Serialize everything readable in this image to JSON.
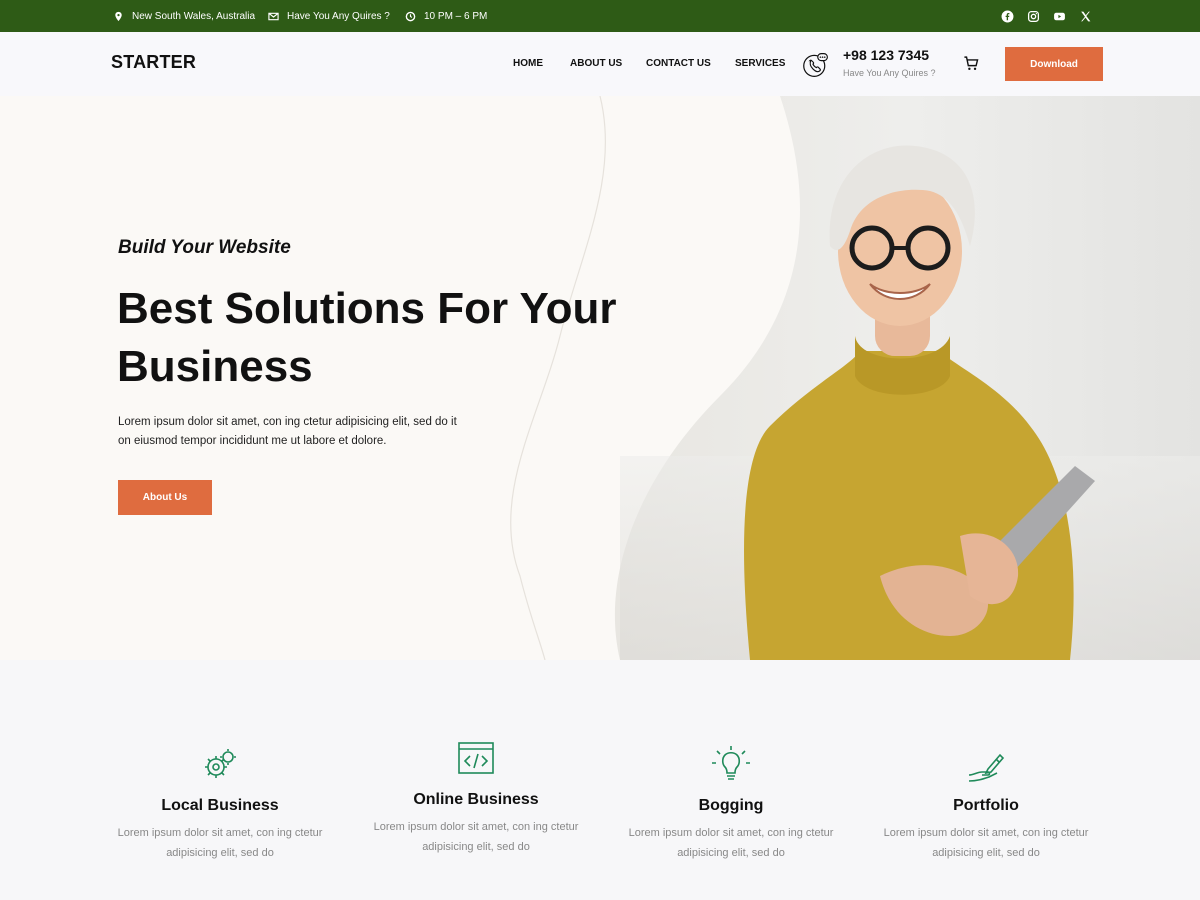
{
  "topbar": {
    "location": "New South Wales, Australia",
    "email": "Have You Any Quires ?",
    "hours": "10 PM – 6 PM",
    "social": [
      "facebook-icon",
      "instagram-icon",
      "youtube-icon",
      "x-icon"
    ]
  },
  "header": {
    "logo": "STARTER",
    "nav": [
      "HOME",
      "ABOUT US",
      "CONTACT US",
      "SERVICES"
    ],
    "phone": "+98 123 7345",
    "phone_sub": "Have You Any Quires ?",
    "download_label": "Download"
  },
  "hero": {
    "eyebrow": "Build Your Website",
    "title_line1": "Best Solutions For Your",
    "title_line2": "Business",
    "text": "Lorem ipsum dolor sit amet, con ing ctetur adipisicing elit, sed do it on eiusmod tempor incididunt me ut labore et dolore.",
    "button_label": "About Us"
  },
  "features": [
    {
      "icon": "gears-icon",
      "title": "Local Business",
      "text": "Lorem ipsum dolor sit amet, con ing ctetur adipisicing elit, sed do"
    },
    {
      "icon": "code-icon",
      "title": "Online Business",
      "text": "Lorem ipsum dolor sit amet, con ing ctetur adipisicing elit, sed do"
    },
    {
      "icon": "lightbulb-icon",
      "title": "Bogging",
      "text": "Lorem ipsum dolor sit amet, con ing ctetur adipisicing elit, sed do"
    },
    {
      "icon": "hand-pen-icon",
      "title": "Portfolio",
      "text": "Lorem ipsum dolor sit amet, con ing ctetur adipisicing elit, sed do"
    }
  ],
  "colors": {
    "topbar_bg": "#2e5b16",
    "accent": "#df6c3f",
    "icon_green": "#1f8a5a"
  }
}
